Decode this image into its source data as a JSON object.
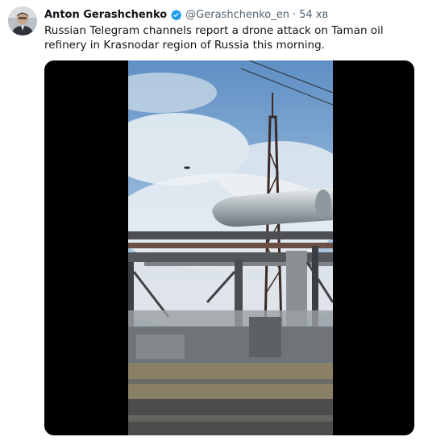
{
  "tweet": {
    "author": {
      "display_name": "Anton Gerashchenko",
      "handle": "@Gerashchenko_en",
      "verified": true,
      "verified_color": "#1d9bf0"
    },
    "separator": "·",
    "timestamp": "54 хв",
    "text": "Russian Telegram channels report a drone attack on Taman oil refinery in Krasnodar region of Russia this morning.",
    "media": {
      "type": "video",
      "icon": "video-frame"
    }
  }
}
